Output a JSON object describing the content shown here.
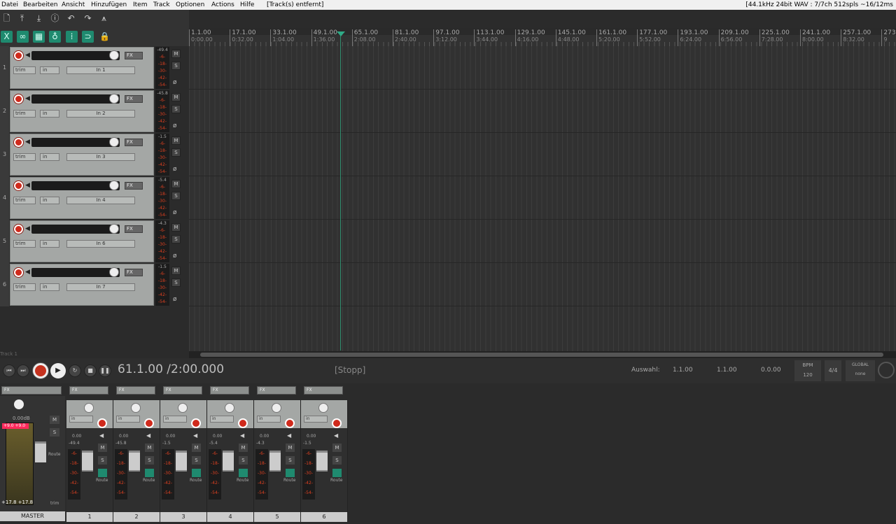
{
  "menu": {
    "items": [
      "Datei",
      "Bearbeiten",
      "Ansicht",
      "Hinzufügen",
      "Item",
      "Track",
      "Optionen",
      "Actions",
      "Hilfe"
    ],
    "status_left": "[Track(s) entfernt]",
    "status_right": "[44.1kHz 24bit WAV : 7/7ch 512spls ~16/12ms"
  },
  "toolbar": {
    "icons": [
      "new-project-icon",
      "save-icon",
      "save-as-icon",
      "info-icon",
      "undo-icon",
      "redo-icon",
      "metronome-icon",
      "ripple-icon",
      "loop-link-icon",
      "grid-icon",
      "snap-icon",
      "grid-dots-icon",
      "auto-crossfade-icon",
      "lock-icon"
    ]
  },
  "ruler": {
    "markers": [
      {
        "bar": "1.1.00",
        "time": "0:00.00"
      },
      {
        "bar": "17.1.00",
        "time": "0:32.00"
      },
      {
        "bar": "33.1.00",
        "time": "1:04.00"
      },
      {
        "bar": "49.1.00",
        "time": "1:36.00"
      },
      {
        "bar": "65.1.00",
        "time": "2:08.00"
      },
      {
        "bar": "81.1.00",
        "time": "2:40.00"
      },
      {
        "bar": "97.1.00",
        "time": "3:12.00"
      },
      {
        "bar": "113.1.00",
        "time": "3:44.00"
      },
      {
        "bar": "129.1.00",
        "time": "4:16.00"
      },
      {
        "bar": "145.1.00",
        "time": "4:48.00"
      },
      {
        "bar": "161.1.00",
        "time": "5:20.00"
      },
      {
        "bar": "177.1.00",
        "time": "5:52.00"
      },
      {
        "bar": "193.1.00",
        "time": "6:24.00"
      },
      {
        "bar": "209.1.00",
        "time": "6:56.00"
      },
      {
        "bar": "225.1.00",
        "time": "7:28.00"
      },
      {
        "bar": "241.1.00",
        "time": "8:00.00"
      },
      {
        "bar": "257.1.00",
        "time": "8:32.00"
      },
      {
        "bar": "273",
        "time": "9"
      }
    ]
  },
  "tracks": [
    {
      "num": "1",
      "input": "in",
      "input_name": "In 1",
      "peak": "-49.4",
      "trim": "trim",
      "fx": "FX"
    },
    {
      "num": "2",
      "input": "in",
      "input_name": "In 2",
      "peak": "-45.8",
      "trim": "trim",
      "fx": "FX"
    },
    {
      "num": "3",
      "input": "in",
      "input_name": "In 3",
      "peak": "-1.5",
      "trim": "trim",
      "fx": "FX"
    },
    {
      "num": "4",
      "input": "in",
      "input_name": "In 4",
      "peak": "-5.4",
      "trim": "trim",
      "fx": "FX"
    },
    {
      "num": "5",
      "input": "in",
      "input_name": "In 6",
      "peak": "-4.3",
      "trim": "trim",
      "fx": "FX"
    },
    {
      "num": "6",
      "input": "in",
      "input_name": "In 7",
      "peak": "-1.5",
      "trim": "trim",
      "fx": "FX"
    }
  ],
  "meter_scale": [
    "-6-",
    "-18-",
    "-30-",
    "-42-",
    "-54-"
  ],
  "track_buttons": {
    "mute": "M",
    "solo": "S",
    "phase": "ø"
  },
  "track_label": "Track 1",
  "transport": {
    "position": "61.1.00 /2:00.000",
    "state": "[Stopp]",
    "selection_label": "Auswahl:",
    "sel_start": "1.1.00",
    "sel_end": "1.1.00",
    "sel_len": "0.0.00",
    "bpm_label": "BPM",
    "bpm": "120",
    "time_sig": "4/4",
    "global_label": "GLOBAL",
    "global_value": "none"
  },
  "mixer": {
    "master": {
      "name": "MASTER",
      "volume": "0.00dB",
      "clip_l": "+9.0",
      "clip_r": "+9.0",
      "peak_l": "+17.8",
      "peak_r": "+17.8",
      "route": "Route",
      "trim": "trim",
      "mute": "M",
      "solo": "S"
    },
    "strips": [
      {
        "name": "1",
        "volume": "0.00",
        "peak": "-49.4",
        "route": "Route"
      },
      {
        "name": "2",
        "volume": "0.00",
        "peak": "-45.8",
        "route": "Route"
      },
      {
        "name": "3",
        "volume": "0.00",
        "peak": "-1.5",
        "route": "Route"
      },
      {
        "name": "4",
        "volume": "0.00",
        "peak": "-5.4",
        "route": "Route"
      },
      {
        "name": "5",
        "volume": "0.00",
        "peak": "-4.3",
        "route": "Route"
      },
      {
        "name": "6",
        "volume": "0.00",
        "peak": "-1.5",
        "route": "Route"
      }
    ],
    "fx_label": "FX",
    "input_label": "in"
  }
}
